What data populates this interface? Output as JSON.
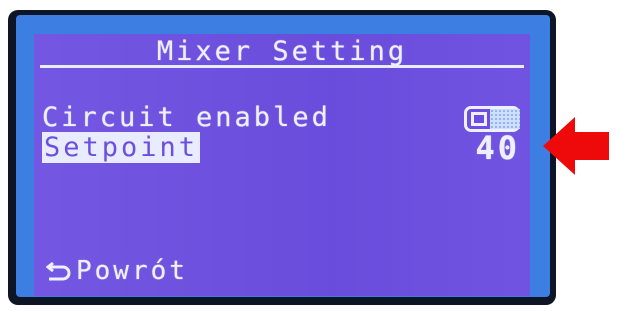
{
  "screen": {
    "title": "Mixer Setting",
    "rows": [
      {
        "label": "Circuit enabled",
        "control": "toggle",
        "toggle_state": "off"
      },
      {
        "label": "Setpoint",
        "value": "40",
        "selected": true
      }
    ],
    "back_label": "Powrót"
  },
  "colors": {
    "lcd_background": "#6c4ee0",
    "backlight": "#3d7ee3",
    "text": "#eef0ff",
    "arrow": "#ee0a0a"
  },
  "icons": {
    "back": "return-arrow-icon",
    "pointer": "red-arrow-icon"
  }
}
